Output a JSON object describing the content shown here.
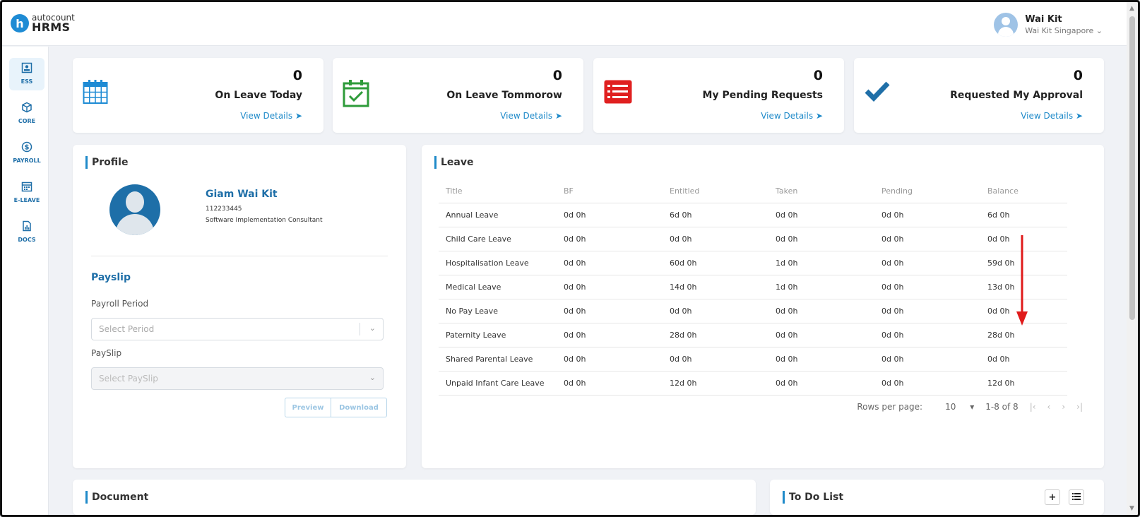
{
  "header": {
    "logo_small": "autocount",
    "logo_large": "HRMS",
    "user_name": "Wai Kit",
    "user_company": "Wai Kit Singapore"
  },
  "sidebar": {
    "items": [
      {
        "label": "ESS",
        "icon": "profile-card-icon",
        "active": true
      },
      {
        "label": "CORE",
        "icon": "cube-icon",
        "active": false
      },
      {
        "label": "PAYROLL",
        "icon": "dollar-icon",
        "active": false
      },
      {
        "label": "E-LEAVE",
        "icon": "calendar-icon",
        "active": false
      },
      {
        "label": "DOCS",
        "icon": "document-chart-icon",
        "active": false
      }
    ]
  },
  "stats": [
    {
      "count": "0",
      "title": "On Leave Today",
      "link": "View Details",
      "icon": "calendar-grid-icon",
      "color": "#1e8bd4"
    },
    {
      "count": "0",
      "title": "On Leave Tommorow",
      "link": "View Details",
      "icon": "calendar-check-icon",
      "color": "#2e9b3a"
    },
    {
      "count": "0",
      "title": "My Pending Requests",
      "link": "View Details",
      "icon": "list-icon",
      "color": "#e02020"
    },
    {
      "count": "0",
      "title": "Requested My Approval",
      "link": "View Details",
      "icon": "checkmark-icon",
      "color": "#1f6fa8"
    }
  ],
  "profile": {
    "section_title": "Profile",
    "name": "Giam Wai Kit",
    "employee_id": "112233445",
    "role": "Software Implementation Consultant"
  },
  "payslip": {
    "title": "Payslip",
    "period_label": "Payroll Period",
    "period_placeholder": "Select Period",
    "payslip_label": "PaySlip",
    "payslip_placeholder": "Select PaySlip",
    "preview_label": "Preview",
    "download_label": "Download"
  },
  "leave": {
    "section_title": "Leave",
    "columns": [
      "Title",
      "BF",
      "Entitled",
      "Taken",
      "Pending",
      "Balance"
    ],
    "rows": [
      [
        "Annual Leave",
        "0d 0h",
        "6d 0h",
        "0d 0h",
        "0d 0h",
        "6d 0h"
      ],
      [
        "Child Care Leave",
        "0d 0h",
        "0d 0h",
        "0d 0h",
        "0d 0h",
        "0d 0h"
      ],
      [
        "Hospitalisation Leave",
        "0d 0h",
        "60d 0h",
        "1d 0h",
        "0d 0h",
        "59d 0h"
      ],
      [
        "Medical Leave",
        "0d 0h",
        "14d 0h",
        "1d 0h",
        "0d 0h",
        "13d 0h"
      ],
      [
        "No Pay Leave",
        "0d 0h",
        "0d 0h",
        "0d 0h",
        "0d 0h",
        "0d 0h"
      ],
      [
        "Paternity Leave",
        "0d 0h",
        "28d 0h",
        "0d 0h",
        "0d 0h",
        "28d 0h"
      ],
      [
        "Shared Parental Leave",
        "0d 0h",
        "0d 0h",
        "0d 0h",
        "0d 0h",
        "0d 0h"
      ],
      [
        "Unpaid Infant Care Leave",
        "0d 0h",
        "12d 0h",
        "0d 0h",
        "0d 0h",
        "12d 0h"
      ]
    ],
    "rows_per_page_label": "Rows per page:",
    "rows_per_page_value": "10",
    "range_text": "1-8 of 8"
  },
  "document": {
    "section_title": "Document"
  },
  "todo": {
    "section_title": "To Do List"
  }
}
